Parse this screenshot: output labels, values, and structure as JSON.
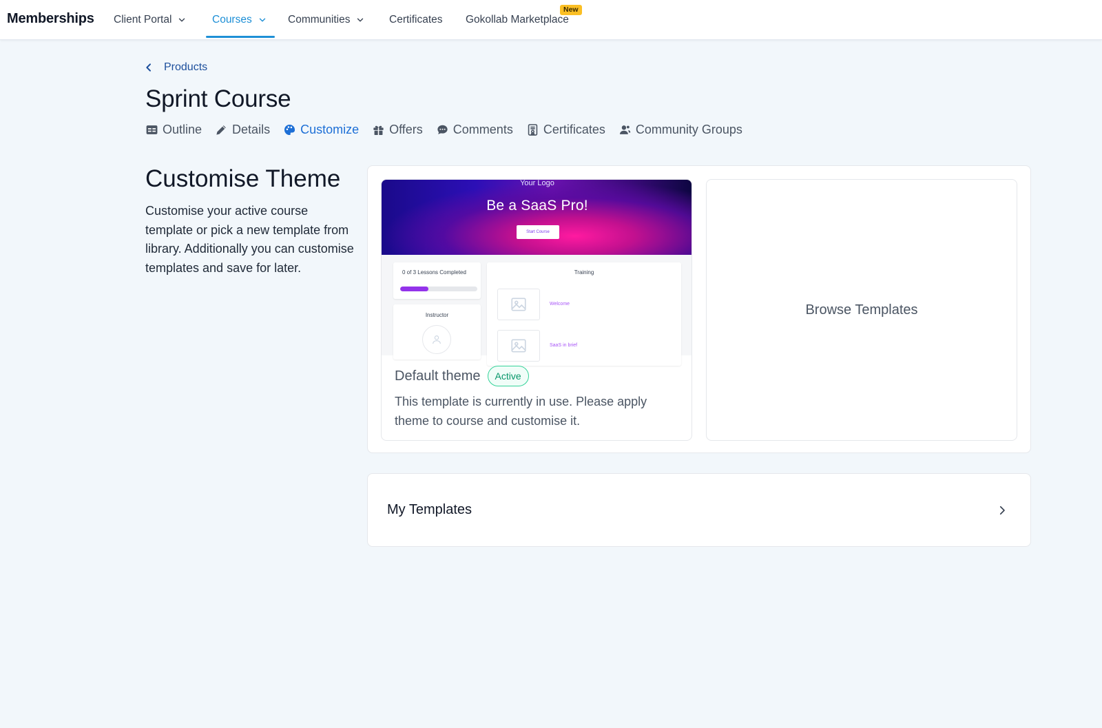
{
  "topnav": {
    "brand": "Memberships",
    "items": [
      {
        "label": "Client Portal",
        "has_dropdown": true,
        "active": false
      },
      {
        "label": "Courses",
        "has_dropdown": true,
        "active": true
      },
      {
        "label": "Communities",
        "has_dropdown": true,
        "active": false
      },
      {
        "label": "Certificates",
        "has_dropdown": false,
        "active": false
      },
      {
        "label": "Gokollab Marketplace",
        "has_dropdown": false,
        "active": false
      }
    ],
    "new_badge": "New"
  },
  "breadcrumb": {
    "label": "Products",
    "icon": "chevron-left-icon"
  },
  "page_title": "Sprint Course",
  "subtabs": [
    {
      "label": "Outline",
      "icon": "table-icon",
      "active": false
    },
    {
      "label": "Details",
      "icon": "pencil-icon",
      "active": false
    },
    {
      "label": "Customize",
      "icon": "palette-icon",
      "active": true
    },
    {
      "label": "Offers",
      "icon": "gift-icon",
      "active": false
    },
    {
      "label": "Comments",
      "icon": "chat-bubble-icon",
      "active": false
    },
    {
      "label": "Certificates",
      "icon": "certificate-icon",
      "active": false
    },
    {
      "label": "Community Groups",
      "icon": "user-group-icon",
      "active": false
    }
  ],
  "section": {
    "title": "Customise Theme",
    "description": "Customise your active course template or pick a new template from library. Additionally you can customise templates and save for later."
  },
  "theme_card": {
    "preview": {
      "logo": "Your Logo",
      "headline": "Be a SaaS Pro!",
      "cta": "Start Course",
      "progress_label": "0 of 3 Lessons Completed",
      "progress_fraction": 0.37,
      "instructor_label": "Instructor",
      "training_label": "Training",
      "lesson_1": "Welcome",
      "lesson_2": "SaaS in brief"
    },
    "title": "Default theme",
    "status_badge": "Active",
    "description": "This template is currently in use. Please apply theme to course and customise it."
  },
  "browse": {
    "label": "Browse Templates"
  },
  "my_templates": {
    "label": "My Templates",
    "icon": "chevron-right-icon"
  },
  "colors": {
    "accent": "#1d8fd6",
    "active_tab": "#1d6fd6",
    "badge_new": "#fbbf24",
    "active_badge": "#34d399",
    "background": "#f2f7fb"
  }
}
